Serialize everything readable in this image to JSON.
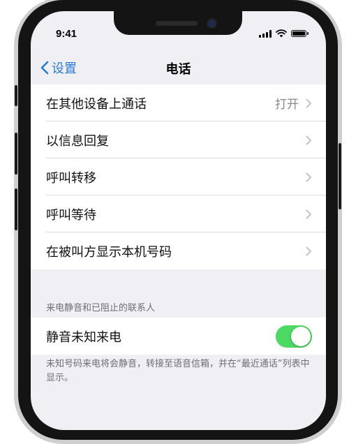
{
  "status": {
    "time": "9:41"
  },
  "nav": {
    "back_label": "设置",
    "title": "电话"
  },
  "rows": [
    {
      "label": "在其他设备上通话",
      "detail": "打开"
    },
    {
      "label": "以信息回复",
      "detail": ""
    },
    {
      "label": "呼叫转移",
      "detail": ""
    },
    {
      "label": "呼叫等待",
      "detail": ""
    },
    {
      "label": "在被叫方显示本机号码",
      "detail": ""
    }
  ],
  "section": {
    "header": "来电静音和已阻止的联系人",
    "toggle_label": "静音未知来电",
    "toggle_on": true,
    "footer": "未知号码来电将会静音，转接至语音信箱，并在“最近通话”列表中显示。"
  },
  "colors": {
    "accent": "#2a7ad6",
    "toggle_on": "#4cd964",
    "background": "#efeff4"
  }
}
